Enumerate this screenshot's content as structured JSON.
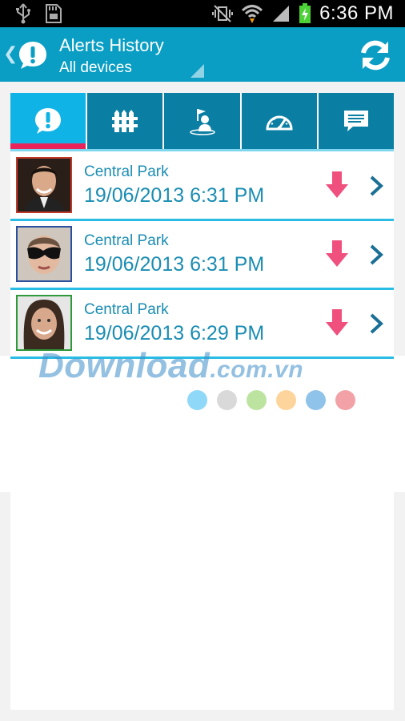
{
  "status_bar": {
    "time": "6:36 PM"
  },
  "action_bar": {
    "title": "Alerts History",
    "subtitle": "All devices"
  },
  "tabs": [
    {
      "name": "alerts",
      "icon": "alert-bubble-icon",
      "active": true
    },
    {
      "name": "geofence",
      "icon": "fence-icon",
      "active": false
    },
    {
      "name": "location",
      "icon": "person-flag-icon",
      "active": false
    },
    {
      "name": "speed",
      "icon": "speedometer-icon",
      "active": false
    },
    {
      "name": "messages",
      "icon": "message-bubble-icon",
      "active": false
    }
  ],
  "alerts": [
    {
      "place": "Central Park",
      "datetime": "19/06/2013 6:31 PM",
      "avatar_border": "#c0392b"
    },
    {
      "place": "Central Park",
      "datetime": "19/06/2013 6:31 PM",
      "avatar_border": "#2a4f9e"
    },
    {
      "place": "Central Park",
      "datetime": "19/06/2013 6:29 PM",
      "avatar_border": "#2e9a3a"
    }
  ],
  "watermark": {
    "main": "Download",
    "tld": ".com.vn"
  },
  "colors": {
    "accent": "#0a9ec4",
    "tab_dark": "#0a7fa3",
    "tab_active": "#10b3e6",
    "tab_indicator": "#e8235a",
    "alert_arrow": "#f0507e",
    "text_primary": "#1b8db3",
    "dots": [
      "#8fd8f7",
      "#d9d9d9",
      "#bde3a0",
      "#fdd59c",
      "#8fc3ea",
      "#f2a2a6"
    ]
  }
}
